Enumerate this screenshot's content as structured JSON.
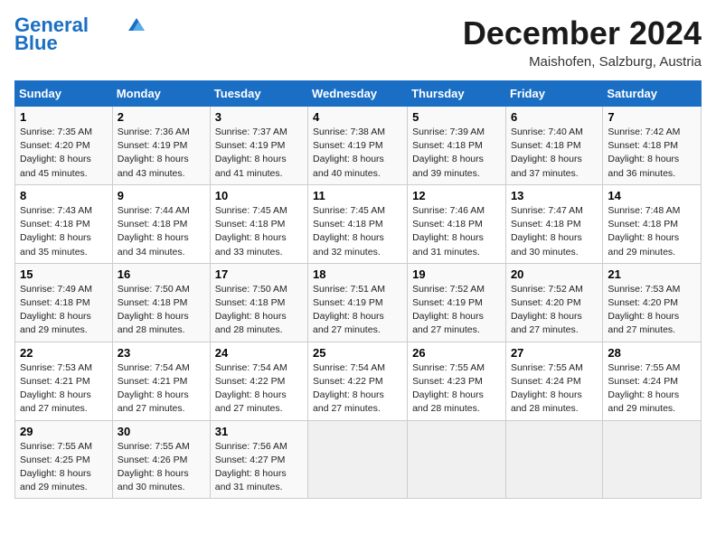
{
  "logo": {
    "line1": "General",
    "line2": "Blue"
  },
  "title": "December 2024",
  "subtitle": "Maishofen, Salzburg, Austria",
  "days_of_week": [
    "Sunday",
    "Monday",
    "Tuesday",
    "Wednesday",
    "Thursday",
    "Friday",
    "Saturday"
  ],
  "weeks": [
    [
      {
        "day": "1",
        "info": "Sunrise: 7:35 AM\nSunset: 4:20 PM\nDaylight: 8 hours and 45 minutes."
      },
      {
        "day": "2",
        "info": "Sunrise: 7:36 AM\nSunset: 4:19 PM\nDaylight: 8 hours and 43 minutes."
      },
      {
        "day": "3",
        "info": "Sunrise: 7:37 AM\nSunset: 4:19 PM\nDaylight: 8 hours and 41 minutes."
      },
      {
        "day": "4",
        "info": "Sunrise: 7:38 AM\nSunset: 4:19 PM\nDaylight: 8 hours and 40 minutes."
      },
      {
        "day": "5",
        "info": "Sunrise: 7:39 AM\nSunset: 4:18 PM\nDaylight: 8 hours and 39 minutes."
      },
      {
        "day": "6",
        "info": "Sunrise: 7:40 AM\nSunset: 4:18 PM\nDaylight: 8 hours and 37 minutes."
      },
      {
        "day": "7",
        "info": "Sunrise: 7:42 AM\nSunset: 4:18 PM\nDaylight: 8 hours and 36 minutes."
      }
    ],
    [
      {
        "day": "8",
        "info": "Sunrise: 7:43 AM\nSunset: 4:18 PM\nDaylight: 8 hours and 35 minutes."
      },
      {
        "day": "9",
        "info": "Sunrise: 7:44 AM\nSunset: 4:18 PM\nDaylight: 8 hours and 34 minutes."
      },
      {
        "day": "10",
        "info": "Sunrise: 7:45 AM\nSunset: 4:18 PM\nDaylight: 8 hours and 33 minutes."
      },
      {
        "day": "11",
        "info": "Sunrise: 7:45 AM\nSunset: 4:18 PM\nDaylight: 8 hours and 32 minutes."
      },
      {
        "day": "12",
        "info": "Sunrise: 7:46 AM\nSunset: 4:18 PM\nDaylight: 8 hours and 31 minutes."
      },
      {
        "day": "13",
        "info": "Sunrise: 7:47 AM\nSunset: 4:18 PM\nDaylight: 8 hours and 30 minutes."
      },
      {
        "day": "14",
        "info": "Sunrise: 7:48 AM\nSunset: 4:18 PM\nDaylight: 8 hours and 29 minutes."
      }
    ],
    [
      {
        "day": "15",
        "info": "Sunrise: 7:49 AM\nSunset: 4:18 PM\nDaylight: 8 hours and 29 minutes."
      },
      {
        "day": "16",
        "info": "Sunrise: 7:50 AM\nSunset: 4:18 PM\nDaylight: 8 hours and 28 minutes."
      },
      {
        "day": "17",
        "info": "Sunrise: 7:50 AM\nSunset: 4:18 PM\nDaylight: 8 hours and 28 minutes."
      },
      {
        "day": "18",
        "info": "Sunrise: 7:51 AM\nSunset: 4:19 PM\nDaylight: 8 hours and 27 minutes."
      },
      {
        "day": "19",
        "info": "Sunrise: 7:52 AM\nSunset: 4:19 PM\nDaylight: 8 hours and 27 minutes."
      },
      {
        "day": "20",
        "info": "Sunrise: 7:52 AM\nSunset: 4:20 PM\nDaylight: 8 hours and 27 minutes."
      },
      {
        "day": "21",
        "info": "Sunrise: 7:53 AM\nSunset: 4:20 PM\nDaylight: 8 hours and 27 minutes."
      }
    ],
    [
      {
        "day": "22",
        "info": "Sunrise: 7:53 AM\nSunset: 4:21 PM\nDaylight: 8 hours and 27 minutes."
      },
      {
        "day": "23",
        "info": "Sunrise: 7:54 AM\nSunset: 4:21 PM\nDaylight: 8 hours and 27 minutes."
      },
      {
        "day": "24",
        "info": "Sunrise: 7:54 AM\nSunset: 4:22 PM\nDaylight: 8 hours and 27 minutes."
      },
      {
        "day": "25",
        "info": "Sunrise: 7:54 AM\nSunset: 4:22 PM\nDaylight: 8 hours and 27 minutes."
      },
      {
        "day": "26",
        "info": "Sunrise: 7:55 AM\nSunset: 4:23 PM\nDaylight: 8 hours and 28 minutes."
      },
      {
        "day": "27",
        "info": "Sunrise: 7:55 AM\nSunset: 4:24 PM\nDaylight: 8 hours and 28 minutes."
      },
      {
        "day": "28",
        "info": "Sunrise: 7:55 AM\nSunset: 4:24 PM\nDaylight: 8 hours and 29 minutes."
      }
    ],
    [
      {
        "day": "29",
        "info": "Sunrise: 7:55 AM\nSunset: 4:25 PM\nDaylight: 8 hours and 29 minutes."
      },
      {
        "day": "30",
        "info": "Sunrise: 7:55 AM\nSunset: 4:26 PM\nDaylight: 8 hours and 30 minutes."
      },
      {
        "day": "31",
        "info": "Sunrise: 7:56 AM\nSunset: 4:27 PM\nDaylight: 8 hours and 31 minutes."
      },
      null,
      null,
      null,
      null
    ]
  ]
}
